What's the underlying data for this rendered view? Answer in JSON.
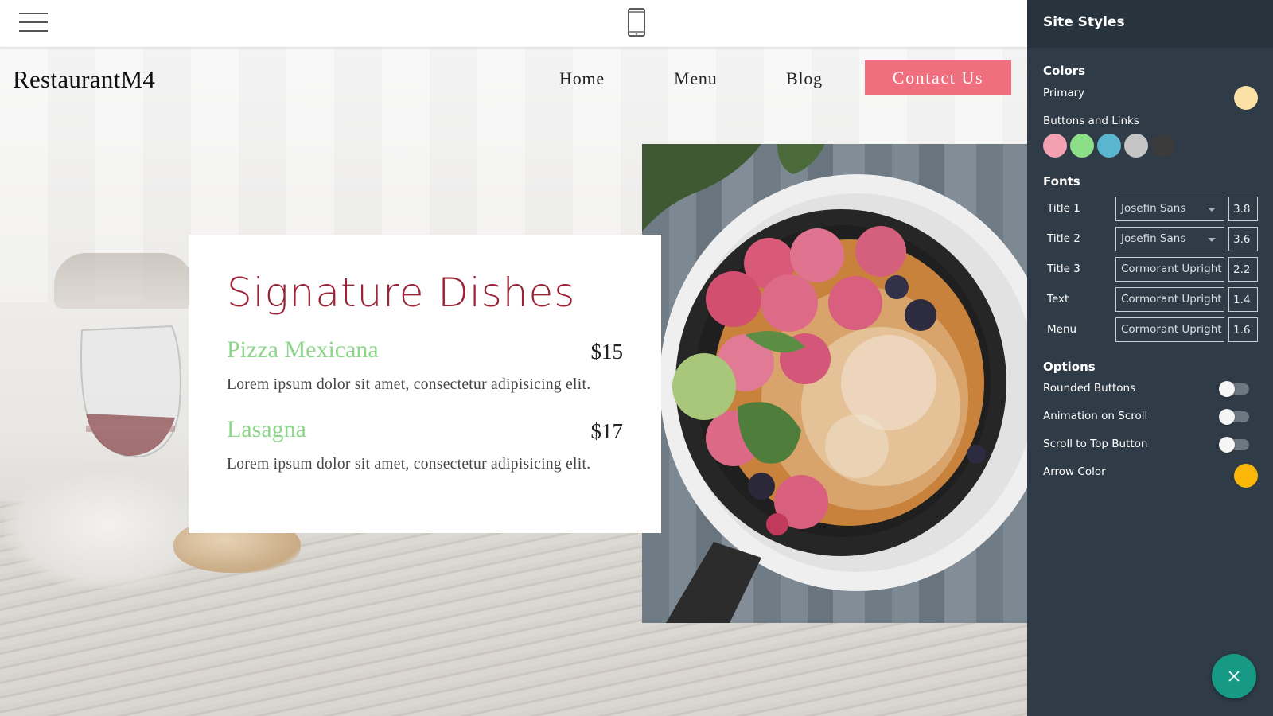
{
  "site": {
    "brand": "RestaurantM4",
    "nav": [
      "Home",
      "Menu",
      "Blog"
    ],
    "contact_button": "Contact Us"
  },
  "menu_card": {
    "title": "Signature Dishes",
    "dishes": [
      {
        "name": "Pizza Mexicana",
        "price": "$15",
        "description": "Lorem ipsum dolor sit amet, consectetur adipisicing elit."
      },
      {
        "name": "Lasagna",
        "price": "$17",
        "description": "Lorem ipsum dolor sit amet, consectetur adipisicing elit."
      }
    ]
  },
  "panel": {
    "title": "Site Styles",
    "colors": {
      "section_title": "Colors",
      "primary_label": "Primary",
      "primary_color": "#fbe0a5",
      "buttons_label": "Buttons and Links",
      "button_swatches": [
        "#f3a0b0",
        "#8ddf87",
        "#5bb6cf",
        "#c5c5c5",
        "#3b3b3b"
      ]
    },
    "fonts": {
      "section_title": "Fonts",
      "rows": [
        {
          "label": "Title 1",
          "font": "Josefin Sans",
          "size": "3.8"
        },
        {
          "label": "Title 2",
          "font": "Josefin Sans",
          "size": "3.6"
        },
        {
          "label": "Title 3",
          "font": "Cormorant Upright",
          "size": "2.2"
        },
        {
          "label": "Text",
          "font": "Cormorant Upright",
          "size": "1.4"
        },
        {
          "label": "Menu",
          "font": "Cormorant Upright",
          "size": "1.6"
        }
      ]
    },
    "options": {
      "section_title": "Options",
      "rounded_buttons": "Rounded Buttons",
      "animation_on_scroll": "Animation on Scroll",
      "scroll_to_top": "Scroll to Top Button",
      "arrow_color_label": "Arrow Color",
      "arrow_color": "#fbb707"
    }
  },
  "colors": {
    "accent_button": "#f06f7f",
    "title_color": "#9b2335",
    "dish_name_color": "#8ed68b",
    "panel_bg": "#2f3c47",
    "fab_bg": "#169a86"
  },
  "icons": [
    "hamburger-icon",
    "mobile-phone-icon",
    "close-icon",
    "dropdown-caret-icon"
  ]
}
